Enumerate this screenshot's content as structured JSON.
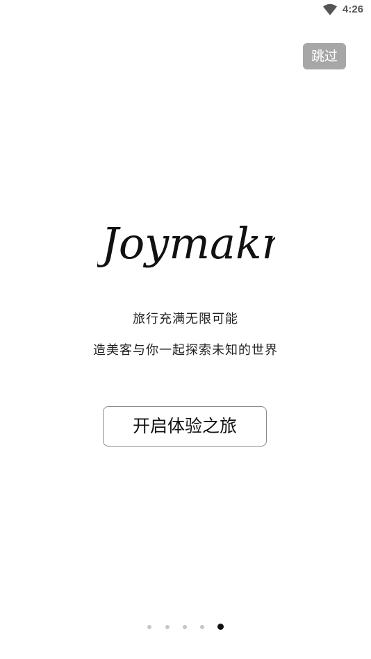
{
  "status_bar": {
    "time": "4:26",
    "icon": "wifi-icon"
  },
  "skip": {
    "label": "跳过"
  },
  "logo": {
    "text": "Joymakr"
  },
  "taglines": {
    "line1": "旅行充满无限可能",
    "line2": "造美客与你一起探索未知的世界"
  },
  "start": {
    "label": "开启体验之旅"
  },
  "pager": {
    "total": 5,
    "active_index": 4
  },
  "colors": {
    "skip_bg": "#a7a7a7",
    "dot_inactive": "#c6c6c6",
    "dot_active": "#111111"
  }
}
